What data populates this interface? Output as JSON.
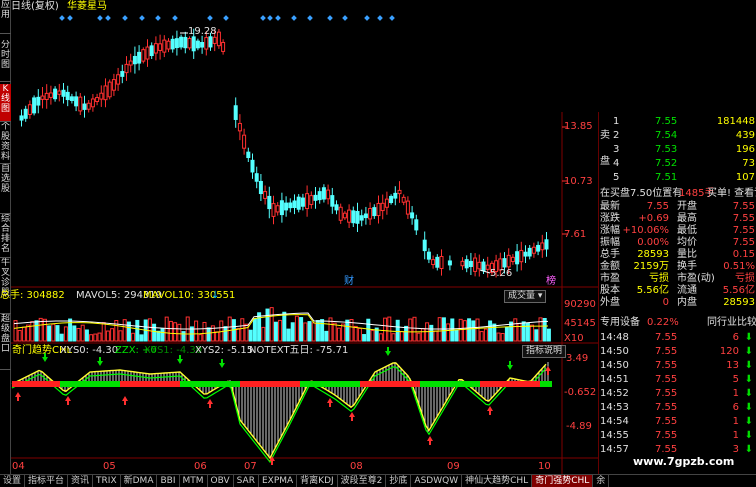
{
  "header": {
    "mode": "日线(复权)",
    "stock_name": "华菱星马"
  },
  "sidebar": {
    "items": [
      {
        "label": "应用",
        "active": false
      },
      {
        "label": "分时图",
        "active": false
      },
      {
        "label": "K线图",
        "active": true
      },
      {
        "label": "个股资料",
        "active": false
      },
      {
        "label": "自选股",
        "active": false
      },
      {
        "label": "综合排名",
        "active": false
      },
      {
        "label": "牛叉诊股",
        "active": false
      },
      {
        "label": "超级盘口",
        "active": false
      }
    ]
  },
  "price_axis": {
    "labels": [
      "13.85",
      "10.73",
      "7.61"
    ]
  },
  "price_annotations": {
    "high": "19.28",
    "low": "5.26",
    "cai": "财",
    "wei": "榜"
  },
  "volume": {
    "total_label": "总手: 304882",
    "mavol5_label": "MAVOL5: 294319",
    "mavol10_label": "MAVOL10: 330551",
    "dropdown": "成交量",
    "axis_top": "90290",
    "axis_mid": "45145",
    "axis_unit": "X10"
  },
  "indicator": {
    "name": "奇门趋势CHL",
    "xys0": "XYS0: -4.30",
    "zzx": "ZZX: +0",
    "xys1": "XYS1: -4.30",
    "xys2": "XYS2: -5.15",
    "notext": "NOTEXT五日: -75.71",
    "explain_button": "指标说明",
    "axis": [
      "3.49",
      "-0.652",
      "-4.89"
    ]
  },
  "x_axis": {
    "labels": [
      "04",
      "05",
      "06",
      "07",
      "08",
      "09",
      "10"
    ]
  },
  "order_book": {
    "sell": [
      {
        "level": "1",
        "price": "7.55",
        "vol": "181448"
      },
      {
        "level": "2",
        "price": "7.54",
        "vol": "439"
      },
      {
        "level": "3",
        "price": "7.53",
        "vol": "196"
      },
      {
        "level": "4",
        "price": "7.52",
        "vol": "73"
      },
      {
        "level": "5",
        "price": "7.51",
        "vol": "107"
      }
    ],
    "side_label_sell": "卖",
    "side_label_pan": "盘"
  },
  "notice": {
    "text": "在买盘7.50位置有",
    "hands": "1485手",
    "link": "买单! 查看详细"
  },
  "quote": {
    "rows": [
      {
        "l1": "最新",
        "v1": "7.55",
        "l2": "开盘",
        "v2": "7.55"
      },
      {
        "l1": "涨跌",
        "v1": "+0.69",
        "l2": "最高",
        "v2": "7.55"
      },
      {
        "l1": "涨幅",
        "v1": "+10.06%",
        "l2": "最低",
        "v2": "7.55"
      },
      {
        "l1": "振幅",
        "v1": "0.00%",
        "l2": "均价",
        "v2": "7.55"
      },
      {
        "l1": "总手",
        "v1": "28593",
        "l2": "量比",
        "v2": "0.15"
      },
      {
        "l1": "金额",
        "v1": "2159万",
        "l2": "换手",
        "v2": "0.51%"
      },
      {
        "l1": "市盈",
        "v1": "亏损",
        "l2": "市盈(动)",
        "v2": "亏损"
      },
      {
        "l1": "股本",
        "v1": "5.56亿",
        "l2": "流通",
        "v2": "5.56亿"
      },
      {
        "l1": "外盘",
        "v1": "0",
        "l2": "内盘",
        "v2": "28593"
      }
    ]
  },
  "sector": {
    "name": "专用设备",
    "change": "0.22%",
    "compare": "同行业比较"
  },
  "ticks": [
    {
      "time": "14:48",
      "price": "7.55",
      "vol": "6"
    },
    {
      "time": "14:50",
      "price": "7.55",
      "vol": "120"
    },
    {
      "time": "14:50",
      "price": "7.55",
      "vol": "13"
    },
    {
      "time": "14:51",
      "price": "7.55",
      "vol": "5"
    },
    {
      "time": "14:52",
      "price": "7.55",
      "vol": "1"
    },
    {
      "time": "14:53",
      "price": "7.55",
      "vol": "6"
    },
    {
      "time": "14:54",
      "price": "7.55",
      "vol": "1"
    },
    {
      "time": "14:55",
      "price": "7.55",
      "vol": "1"
    },
    {
      "time": "14:57",
      "price": "7.55",
      "vol": "3"
    }
  ],
  "bottom_tabs": [
    {
      "label": "设置",
      "active": false
    },
    {
      "label": "指标平台",
      "active": false
    },
    {
      "label": "资讯",
      "active": false
    },
    {
      "label": "TRIX",
      "active": false
    },
    {
      "label": "新DMA",
      "active": false
    },
    {
      "label": "BBI",
      "active": false
    },
    {
      "label": "MTM",
      "active": false
    },
    {
      "label": "OBV",
      "active": false
    },
    {
      "label": "SAR",
      "active": false
    },
    {
      "label": "EXPMA",
      "active": false
    },
    {
      "label": "背离KDJ",
      "active": false
    },
    {
      "label": "波段至尊2",
      "active": false
    },
    {
      "label": "抄底",
      "active": false
    },
    {
      "label": "ASDWQW",
      "active": false
    },
    {
      "label": "神仙大趋势CHL",
      "active": false
    },
    {
      "label": "奇门强势CHL",
      "active": true
    },
    {
      "label": "余",
      "active": false
    }
  ],
  "watermark": "www.7gpzb.com",
  "colors": {
    "up": "#ff3030",
    "down": "#54ffff",
    "ma5": "#ffffff",
    "ma10": "#ffff00",
    "panel_border": "#800000"
  }
}
